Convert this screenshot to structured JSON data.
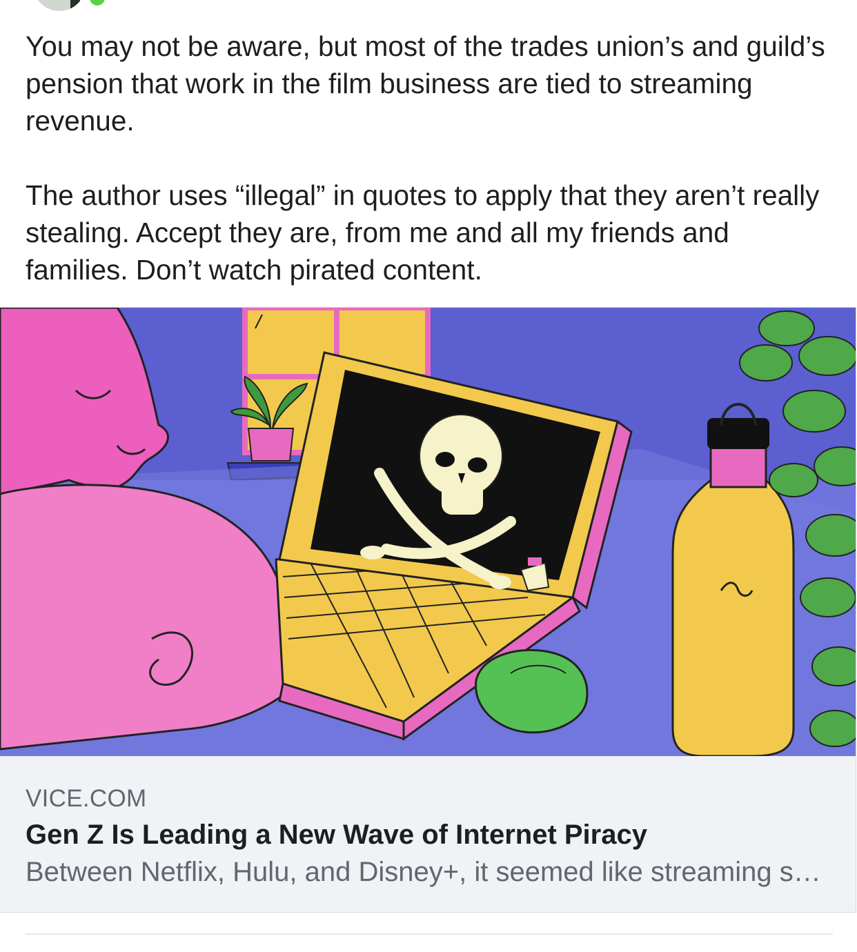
{
  "post": {
    "paragraphs": [
      "You may not be aware, but most of the trades union’s and guild’s pension that work in the film business are tied to streaming revenue.",
      "The author uses “illegal” in quotes to apply that they aren’t really stealing.  Accept they are,  from me and all my friends and families.  Don’t watch pirated content."
    ]
  },
  "link_card": {
    "domain": "VICE.COM",
    "title": "Gen Z Is Leading a New Wave of Internet Piracy",
    "description": "Between Netflix, Hulu, and Disney+, it seemed like streaming services had finally killed piracy."
  },
  "colors": {
    "presence": "#5ad047",
    "card_background": "#f0f2f5",
    "text_primary": "#1c1e21",
    "text_secondary": "#606770"
  }
}
